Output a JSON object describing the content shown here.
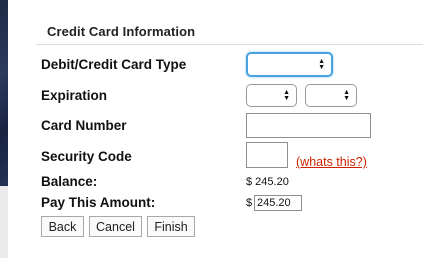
{
  "section": {
    "title": "Credit Card Information"
  },
  "fields": {
    "card_type_label": "Debit/Credit Card Type",
    "card_type_value": "",
    "expiration_label": "Expiration",
    "expiration_month_value": "",
    "expiration_year_value": "",
    "card_number_label": "Card Number",
    "card_number_value": "",
    "security_code_label": "Security Code",
    "security_code_value": "",
    "whats_this_link": "(whats this?)",
    "balance_label": "Balance:",
    "balance_value": "$ 245.20",
    "pay_label": "Pay This Amount:",
    "pay_currency": "$",
    "pay_amount_value": "245.20"
  },
  "buttons": {
    "back": "Back",
    "cancel": "Cancel",
    "finish": "Finish"
  },
  "colors": {
    "focus_ring": "#4aa3df",
    "link": "#cc2200",
    "left_bar": "#1f2a44"
  },
  "icons": {
    "select_arrows": "up-down-chevron-icon"
  }
}
